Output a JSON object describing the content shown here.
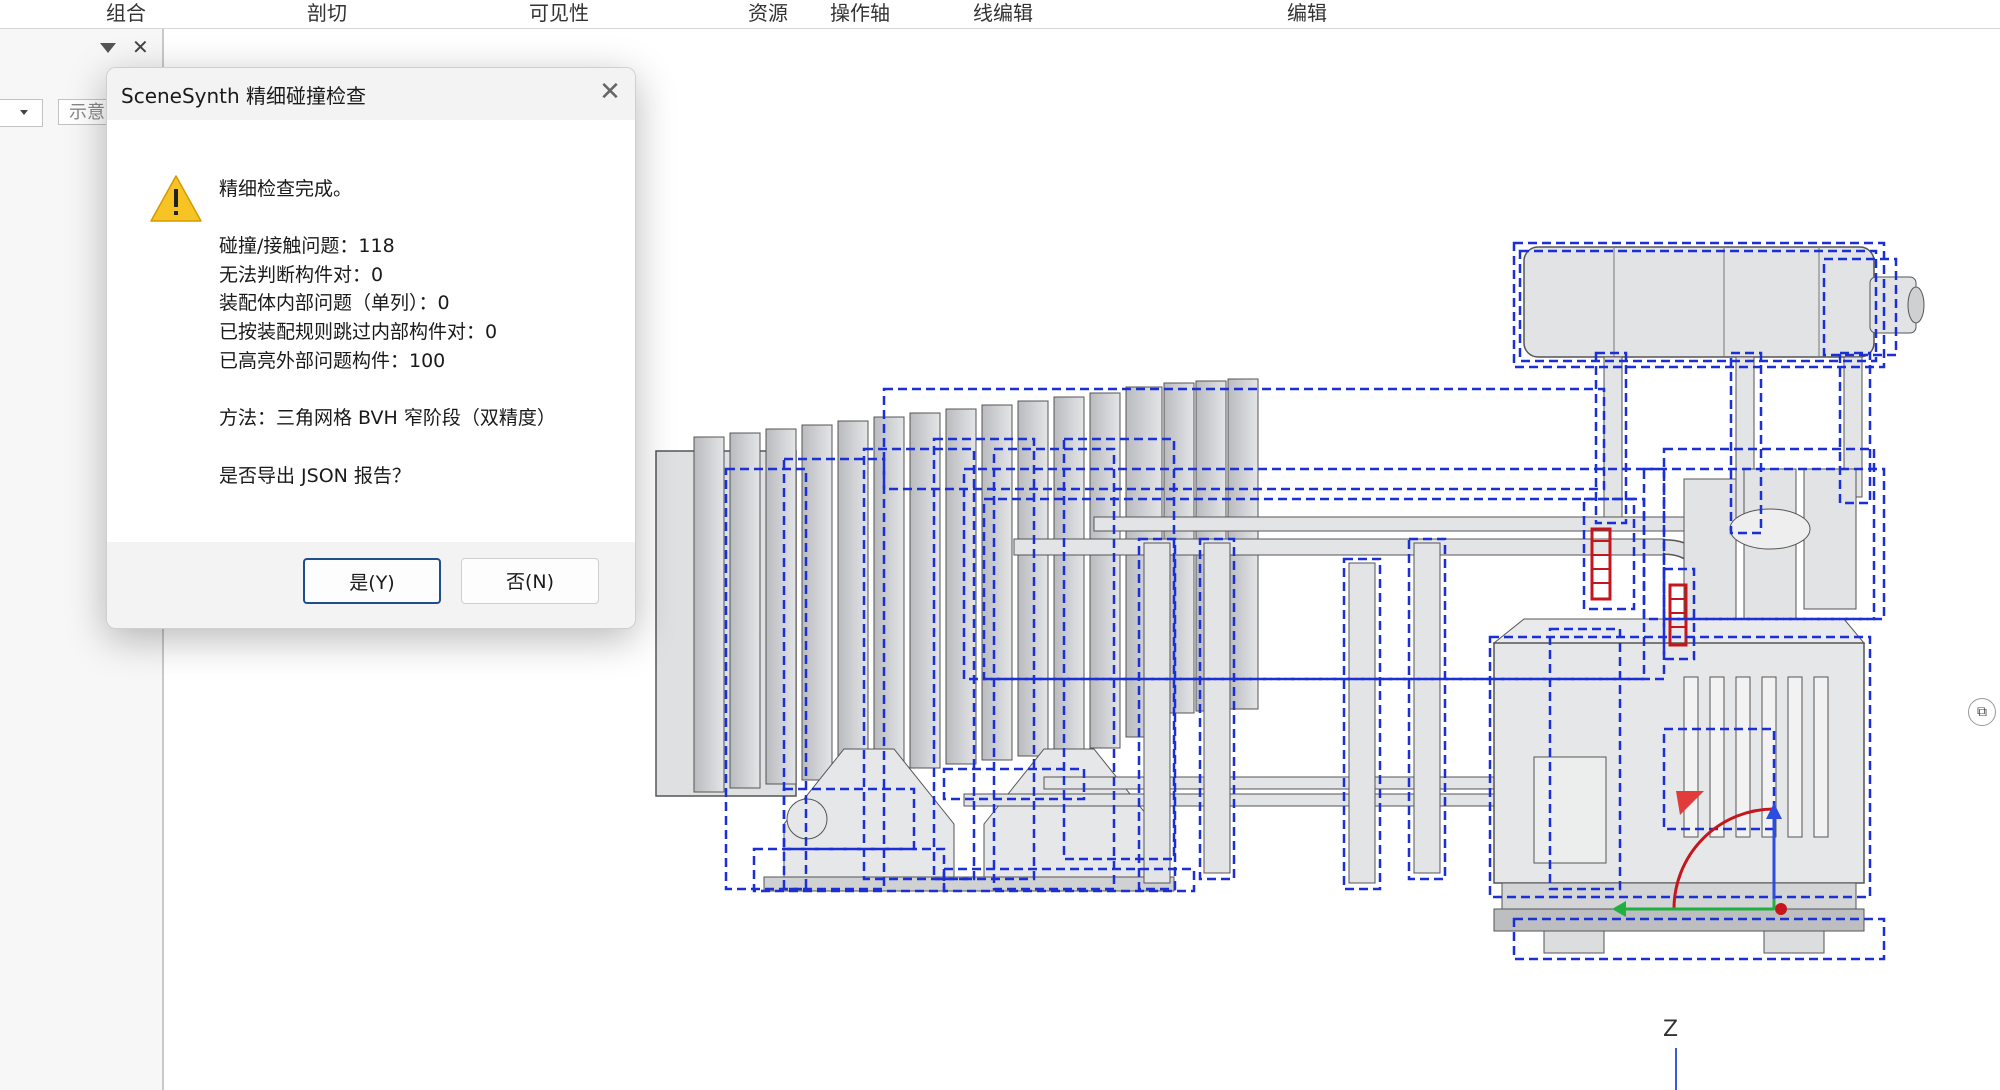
{
  "ribbon": {
    "labels": [
      "组合",
      "剖切",
      "可见性",
      "资源",
      "操作轴",
      "线编辑",
      "编辑"
    ]
  },
  "left_panel": {
    "field_text": "示意"
  },
  "viewport": {
    "axis_label": "Z",
    "colors": {
      "bbox": "#1a2fd6",
      "model": "#d9dadc",
      "highlight": "#c4161c"
    }
  },
  "dialog": {
    "title": "SceneSynth 精细碰撞检查",
    "icon": "warning-icon",
    "heading": "精细检查完成。",
    "stats": [
      "碰撞/接触问题：118",
      "无法判断构件对：0",
      "装配体内部问题（单列）：0",
      "已按装配规则跳过内部构件对：0",
      "已高亮外部问题构件：100"
    ],
    "method": "方法：三角网格 BVH 窄阶段（双精度）",
    "question": "是否导出 JSON 报告？",
    "yes_label": "是(Y)",
    "no_label": "否(N)"
  }
}
